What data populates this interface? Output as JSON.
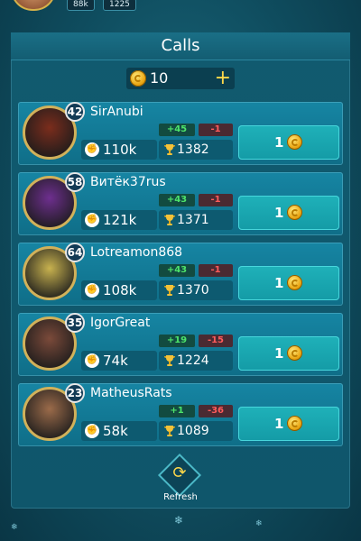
{
  "top": {
    "stat1": "88k",
    "stat2": "1225"
  },
  "panel": {
    "title": "Calls",
    "coins": "10",
    "plus": "+"
  },
  "players": [
    {
      "level": "42",
      "name": "SirAnubi",
      "power": "110k",
      "gain": "+45",
      "loss": "-1",
      "trophies": "1382",
      "cost": "1",
      "avatar_color": "#7b2d1c"
    },
    {
      "level": "58",
      "name": "Витёк37rus",
      "power": "121k",
      "gain": "+43",
      "loss": "-1",
      "trophies": "1371",
      "cost": "1",
      "avatar_color": "#6e2f8f"
    },
    {
      "level": "64",
      "name": "Lotreamon868",
      "power": "108k",
      "gain": "+43",
      "loss": "-1",
      "trophies": "1370",
      "cost": "1",
      "avatar_color": "#c8b24f"
    },
    {
      "level": "35",
      "name": "IgorGreat",
      "power": "74k",
      "gain": "+19",
      "loss": "-15",
      "trophies": "1224",
      "cost": "1",
      "avatar_color": "#7b4a3a"
    },
    {
      "level": "23",
      "name": "MatheusRats",
      "power": "58k",
      "gain": "+1",
      "loss": "-36",
      "trophies": "1089",
      "cost": "1",
      "avatar_color": "#9b6b4a"
    }
  ],
  "refresh": {
    "label": "Refresh"
  },
  "icons": {
    "coin": "coin-icon",
    "power": "fist-icon",
    "trophy": "trophy-icon",
    "refresh": "refresh-icon"
  },
  "colors": {
    "gain": "#4de36a",
    "loss": "#ff5b5b",
    "button": "#1fb1b9",
    "gold": "#ffd84a"
  }
}
